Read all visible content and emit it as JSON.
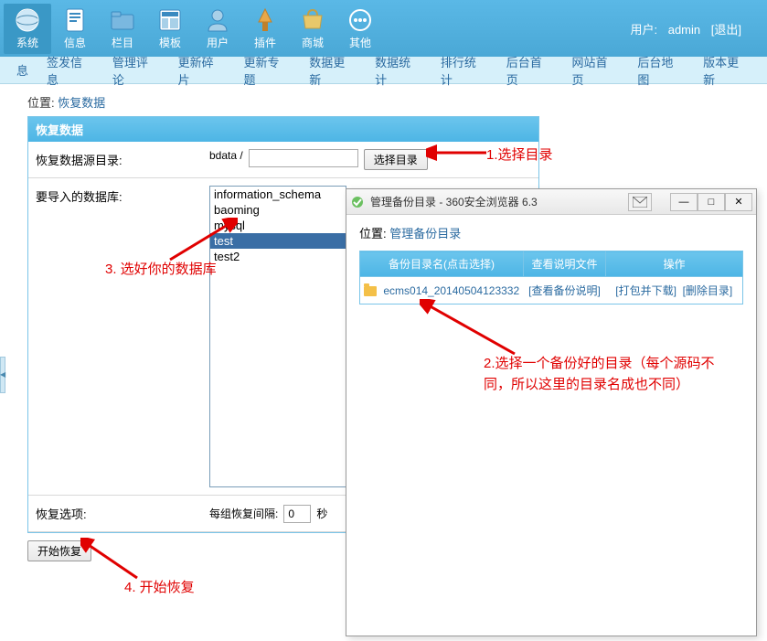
{
  "topnav": {
    "items": [
      {
        "label": "系统",
        "icon": "globe"
      },
      {
        "label": "信息",
        "icon": "doc"
      },
      {
        "label": "栏目",
        "icon": "folder"
      },
      {
        "label": "模板",
        "icon": "template"
      },
      {
        "label": "用户",
        "icon": "user"
      },
      {
        "label": "插件",
        "icon": "plugin"
      },
      {
        "label": "商城",
        "icon": "shop"
      },
      {
        "label": "其他",
        "icon": "other"
      }
    ],
    "user_label": "用户:",
    "username": "admin",
    "logout": "[退出]"
  },
  "subnav": {
    "items": [
      "息",
      "签发信息",
      "管理评论",
      "更新碎片",
      "更新专题",
      "数据更新",
      "数据统计",
      "排行统计",
      "后台首页",
      "网站首页",
      "后台地图",
      "版本更新"
    ]
  },
  "breadcrumb": {
    "label": "位置:",
    "link": "恢复数据"
  },
  "panel": {
    "title": "恢复数据",
    "row1_label": "恢复数据源目录:",
    "bdata_prefix": "bdata /",
    "bdata_input": "",
    "choose_dir_btn": "选择目录",
    "row2_label": "要导入的数据库:",
    "db_options": [
      "information_schema",
      "baoming",
      "mysql",
      "test",
      "test2"
    ],
    "db_selected_index": 3,
    "row3_label": "恢复选项:",
    "interval_label": "每组恢复间隔:",
    "interval_value": "0",
    "interval_unit": "秒",
    "start_btn": "开始恢复"
  },
  "annotations": {
    "a1": "1.选择目录",
    "a2": "2.选择一个备份好的目录（每个源码不同，所以这里的目录名成也不同）",
    "a3": "3.  选好你的数据库",
    "a4": "4.  开始恢复"
  },
  "popup": {
    "title": "管理备份目录 - 360安全浏览器 6.3",
    "bc_label": "位置:",
    "bc_link": "管理备份目录",
    "th_name": "备份目录名(点击选择)",
    "th_view": "查看说明文件",
    "th_ops": "操作",
    "row_name": "ecms014_20140504123332",
    "row_view": "[查看备份说明]",
    "row_pack": "[打包并下载]",
    "row_del": "[删除目录]"
  }
}
